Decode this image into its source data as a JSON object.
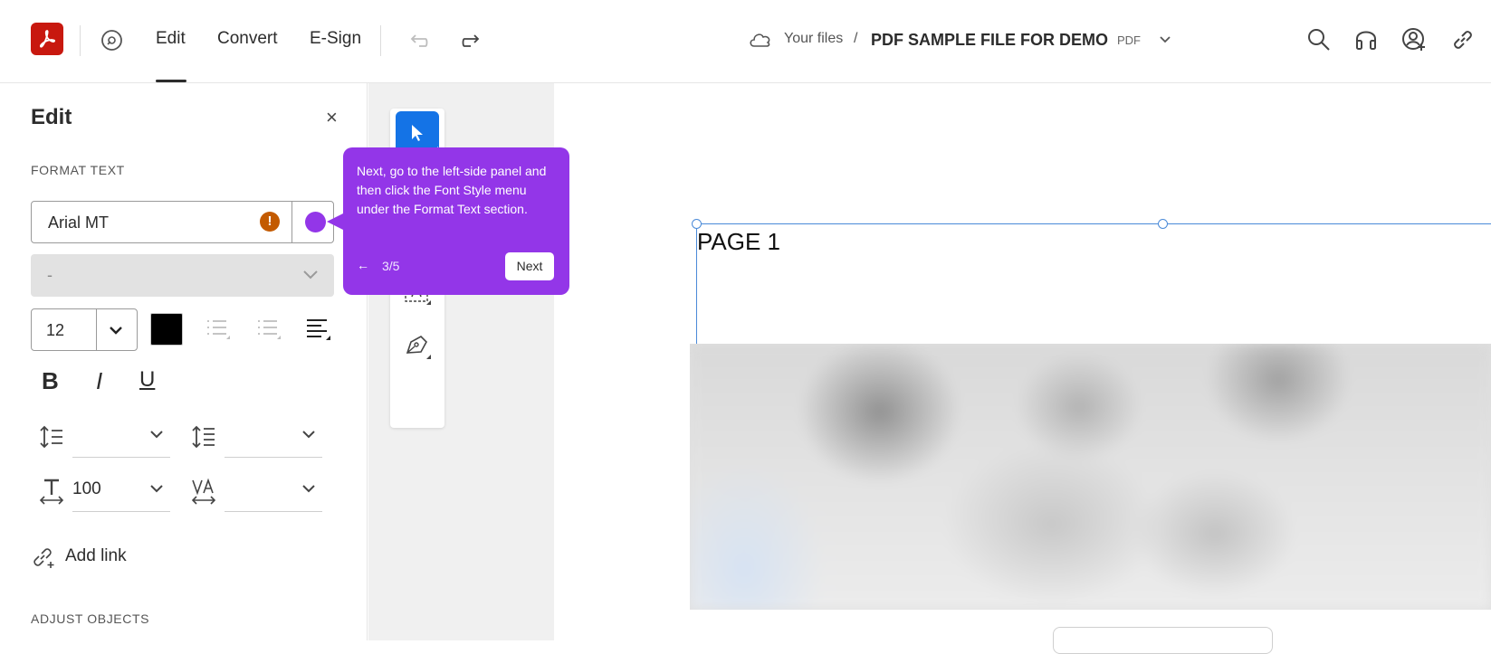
{
  "header": {
    "nav": [
      "Edit",
      "Convert",
      "E-Sign"
    ],
    "breadcrumb_root": "Your files",
    "breadcrumb_sep": "/",
    "doc_title": "PDF SAMPLE FILE FOR DEMO",
    "doc_type": "PDF",
    "icons": [
      "search-icon",
      "headphones-icon",
      "account-add-icon",
      "link-icon"
    ]
  },
  "panel": {
    "title": "Edit",
    "close": "×",
    "format_section": "FORMAT TEXT",
    "font_name": "Arial MT",
    "font_warning": "!",
    "font_style": "-",
    "font_size": "12",
    "text_color": "#000000",
    "bold": "B",
    "italic": "I",
    "underline": "U",
    "char_scale": "100",
    "add_link": "Add link",
    "adjust_section": "ADJUST OBJECTS"
  },
  "tooltip": {
    "text": "Next, go to the left-side panel and then click the Font Style menu under the Format Text section.",
    "back": "←",
    "step": "3/5",
    "next": "Next",
    "color": "#9336e8"
  },
  "document": {
    "page_label": "PAGE 1"
  }
}
